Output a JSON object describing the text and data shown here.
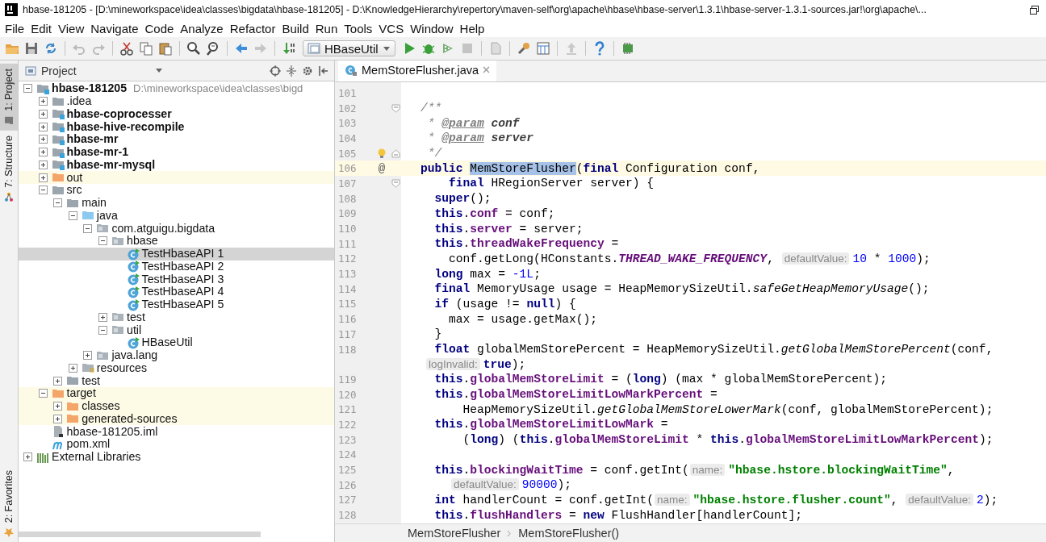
{
  "window": {
    "title": "hbase-181205 - [D:\\mineworkspace\\idea\\classes\\bigdata\\hbase-181205] - D:\\KnowledgeHierarchy\\repertory\\maven-self\\org\\apache\\hbase\\hbase-server\\1.3.1\\hbase-server-1.3.1-sources.jar!\\org\\apache\\..."
  },
  "menu": [
    "File",
    "Edit",
    "View",
    "Navigate",
    "Code",
    "Analyze",
    "Refactor",
    "Build",
    "Run",
    "Tools",
    "VCS",
    "Window",
    "Help"
  ],
  "toolbar": {
    "run_config": "HBaseUtil"
  },
  "tool_windows": [
    {
      "label": "1: Project",
      "selected": true
    },
    {
      "label": "7: Structure",
      "selected": false
    }
  ],
  "tool_windows_bottom": [
    {
      "label": "2: Favorites",
      "selected": false
    }
  ],
  "project": {
    "title": "Project",
    "tree": [
      {
        "label": "hbase-181205",
        "path": "D:\\mineworkspace\\idea\\classes\\bigd",
        "kind": "module",
        "expanded": true,
        "selected": false,
        "children": [
          {
            "label": ".idea",
            "kind": "folder",
            "expanded": false,
            "selected": false
          },
          {
            "label": "hbase-coprocesser",
            "kind": "module",
            "expanded": false,
            "selected": false
          },
          {
            "label": "hbase-hive-recompile",
            "kind": "module",
            "expanded": false,
            "selected": false
          },
          {
            "label": "hbase-mr",
            "kind": "module",
            "expanded": false,
            "selected": false
          },
          {
            "label": "hbase-mr-1",
            "kind": "module",
            "expanded": false,
            "selected": false
          },
          {
            "label": "hbase-mr-mysql",
            "kind": "module",
            "expanded": false,
            "selected": false
          },
          {
            "label": "out",
            "kind": "excluded",
            "expanded": false,
            "selected": false
          },
          {
            "label": "src",
            "kind": "folder",
            "expanded": true,
            "selected": false,
            "children": [
              {
                "label": "main",
                "kind": "folder",
                "expanded": true,
                "selected": false,
                "children": [
                  {
                    "label": "java",
                    "kind": "source",
                    "expanded": true,
                    "selected": false,
                    "children": [
                      {
                        "label": "com.atguigu.bigdata",
                        "kind": "package",
                        "expanded": true,
                        "selected": false,
                        "children": [
                          {
                            "label": "hbase",
                            "kind": "package",
                            "expanded": true,
                            "selected": false,
                            "children": [
                              {
                                "label": "TestHbaseAPI 1",
                                "kind": "class",
                                "selected": true
                              },
                              {
                                "label": "TestHbaseAPI 2",
                                "kind": "class",
                                "selected": false
                              },
                              {
                                "label": "TestHbaseAPI 3",
                                "kind": "class",
                                "selected": false
                              },
                              {
                                "label": "TestHbaseAPI 4",
                                "kind": "class",
                                "selected": false
                              },
                              {
                                "label": "TestHbaseAPI 5",
                                "kind": "class",
                                "selected": false
                              }
                            ]
                          },
                          {
                            "label": "test",
                            "kind": "package",
                            "expanded": false,
                            "selected": false
                          },
                          {
                            "label": "util",
                            "kind": "package",
                            "expanded": true,
                            "selected": false,
                            "children": [
                              {
                                "label": "HBaseUtil",
                                "kind": "class",
                                "selected": false
                              }
                            ]
                          }
                        ]
                      },
                      {
                        "label": "java.lang",
                        "kind": "package",
                        "expanded": false,
                        "selected": false
                      }
                    ]
                  },
                  {
                    "label": "resources",
                    "kind": "resources",
                    "expanded": false,
                    "selected": false
                  }
                ]
              },
              {
                "label": "test",
                "kind": "folder",
                "expanded": false,
                "selected": false
              }
            ]
          },
          {
            "label": "target",
            "kind": "excluded",
            "expanded": true,
            "selected": false,
            "children": [
              {
                "label": "classes",
                "kind": "excluded",
                "expanded": false,
                "selected": false
              },
              {
                "label": "generated-sources",
                "kind": "excluded",
                "expanded": false,
                "selected": false
              }
            ]
          },
          {
            "label": "hbase-181205.iml",
            "kind": "iml",
            "selected": false
          },
          {
            "label": "pom.xml",
            "kind": "maven",
            "selected": false
          }
        ]
      },
      {
        "label": "External Libraries",
        "kind": "libraries",
        "expanded": false,
        "selected": false
      }
    ]
  },
  "editor": {
    "tabs": [
      {
        "label": "MemStoreFlusher.java",
        "selected": true
      }
    ],
    "lines": [
      {
        "number": "101",
        "current": false
      },
      {
        "number": "102",
        "current": false,
        "fold_start": true,
        "segments": [
          {
            "kind": "comment",
            "text": "/**"
          }
        ]
      },
      {
        "number": "103",
        "current": false,
        "segments": [
          {
            "kind": "comment",
            "text": " * "
          },
          {
            "kind": "doctag",
            "text": "@param"
          },
          {
            "kind": "docparam",
            "text": " conf"
          }
        ]
      },
      {
        "number": "104",
        "current": false,
        "segments": [
          {
            "kind": "comment",
            "text": " * "
          },
          {
            "kind": "doctag",
            "text": "@param"
          },
          {
            "kind": "docparam",
            "text": " server"
          }
        ]
      },
      {
        "number": "105",
        "current": false,
        "fold_end": true,
        "bulb": true,
        "segments": [
          {
            "kind": "comment",
            "text": " */"
          }
        ]
      },
      {
        "number": "106",
        "current": true,
        "gutter_mark": "@",
        "segments": [
          {
            "kind": "keyword",
            "text": "public "
          },
          {
            "kind": "selection",
            "text": "MemStoreFlusher"
          },
          {
            "kind": "plain",
            "text": "("
          },
          {
            "kind": "keyword",
            "text": "final "
          },
          {
            "kind": "plain",
            "text": "Configuration conf,"
          }
        ]
      },
      {
        "number": "107",
        "current": false,
        "fold_start": true,
        "segments": [
          {
            "kind": "keyword",
            "text": "    final "
          },
          {
            "kind": "plain",
            "text": "HRegionServer server) {"
          }
        ]
      },
      {
        "number": "108",
        "current": false,
        "segments": [
          {
            "kind": "keyword",
            "text": "  super"
          },
          {
            "kind": "plain",
            "text": "();"
          }
        ]
      },
      {
        "number": "109",
        "current": false,
        "segments": [
          {
            "kind": "keyword",
            "text": "  this"
          },
          {
            "kind": "plain",
            "text": "."
          },
          {
            "kind": "field",
            "text": "conf"
          },
          {
            "kind": "plain",
            "text": " = conf;"
          }
        ]
      },
      {
        "number": "110",
        "current": false,
        "segments": [
          {
            "kind": "keyword",
            "text": "  this"
          },
          {
            "kind": "plain",
            "text": "."
          },
          {
            "kind": "field",
            "text": "server"
          },
          {
            "kind": "plain",
            "text": " = server;"
          }
        ]
      },
      {
        "number": "111",
        "current": false,
        "segments": [
          {
            "kind": "keyword",
            "text": "  this"
          },
          {
            "kind": "plain",
            "text": "."
          },
          {
            "kind": "field",
            "text": "threadWakeFrequency"
          },
          {
            "kind": "plain",
            "text": " ="
          }
        ]
      },
      {
        "number": "112",
        "current": false,
        "segments": [
          {
            "kind": "plain",
            "text": "    conf.getLong(HConstants."
          },
          {
            "kind": "constant",
            "text": "THREAD_WAKE_FREQUENCY"
          },
          {
            "kind": "plain",
            "text": ", "
          },
          {
            "kind": "hint",
            "text": "defaultValue:"
          },
          {
            "kind": "number",
            "text": "10"
          },
          {
            "kind": "plain",
            "text": " * "
          },
          {
            "kind": "number",
            "text": "1000"
          },
          {
            "kind": "plain",
            "text": ");"
          }
        ]
      },
      {
        "number": "113",
        "current": false,
        "segments": [
          {
            "kind": "keyword",
            "text": "  long "
          },
          {
            "kind": "plain",
            "text": "max = "
          },
          {
            "kind": "number",
            "text": "-1L"
          },
          {
            "kind": "plain",
            "text": ";"
          }
        ]
      },
      {
        "number": "114",
        "current": false,
        "segments": [
          {
            "kind": "keyword",
            "text": "  final "
          },
          {
            "kind": "plain",
            "text": "MemoryUsage usage = HeapMemorySizeUtil."
          },
          {
            "kind": "method",
            "text": "safeGetHeapMemoryUsage"
          },
          {
            "kind": "plain",
            "text": "();"
          }
        ]
      },
      {
        "number": "115",
        "current": false,
        "segments": [
          {
            "kind": "keyword",
            "text": "  if "
          },
          {
            "kind": "plain",
            "text": "(usage != "
          },
          {
            "kind": "keyword",
            "text": "null"
          },
          {
            "kind": "plain",
            "text": ") {"
          }
        ]
      },
      {
        "number": "116",
        "current": false,
        "segments": [
          {
            "kind": "plain",
            "text": "    max = usage.getMax();"
          }
        ]
      },
      {
        "number": "117",
        "current": false,
        "segments": [
          {
            "kind": "plain",
            "text": "  }"
          }
        ]
      },
      {
        "number": "118",
        "current": false,
        "segments": [
          {
            "kind": "keyword",
            "text": "  float "
          },
          {
            "kind": "plain",
            "text": "globalMemStorePercent = HeapMemorySizeUtil."
          },
          {
            "kind": "method",
            "text": "getGlobalMemStorePercent"
          },
          {
            "kind": "plain",
            "text": "(conf,"
          }
        ],
        "wrap": [
          {
            "kind": "hint",
            "text": "logInvalid:"
          },
          {
            "kind": "keyword",
            "text": "true"
          },
          {
            "kind": "plain",
            "text": ");"
          }
        ]
      },
      {
        "number": "119",
        "current": false,
        "segments": [
          {
            "kind": "keyword",
            "text": "  this"
          },
          {
            "kind": "plain",
            "text": "."
          },
          {
            "kind": "field",
            "text": "globalMemStoreLimit"
          },
          {
            "kind": "plain",
            "text": " = ("
          },
          {
            "kind": "keyword",
            "text": "long"
          },
          {
            "kind": "plain",
            "text": ") (max * globalMemStorePercent);"
          }
        ]
      },
      {
        "number": "120",
        "current": false,
        "segments": [
          {
            "kind": "keyword",
            "text": "  this"
          },
          {
            "kind": "plain",
            "text": "."
          },
          {
            "kind": "field",
            "text": "globalMemStoreLimitLowMarkPercent"
          },
          {
            "kind": "plain",
            "text": " ="
          }
        ]
      },
      {
        "number": "121",
        "current": false,
        "segments": [
          {
            "kind": "plain",
            "text": "      HeapMemorySizeUtil."
          },
          {
            "kind": "method",
            "text": "getGlobalMemStoreLowerMark"
          },
          {
            "kind": "plain",
            "text": "(conf, globalMemStorePercent);"
          }
        ]
      },
      {
        "number": "122",
        "current": false,
        "segments": [
          {
            "kind": "keyword",
            "text": "  this"
          },
          {
            "kind": "plain",
            "text": "."
          },
          {
            "kind": "field",
            "text": "globalMemStoreLimitLowMark"
          },
          {
            "kind": "plain",
            "text": " ="
          }
        ]
      },
      {
        "number": "123",
        "current": false,
        "segments": [
          {
            "kind": "plain",
            "text": "      ("
          },
          {
            "kind": "keyword",
            "text": "long"
          },
          {
            "kind": "plain",
            "text": ") ("
          },
          {
            "kind": "keyword",
            "text": "this"
          },
          {
            "kind": "plain",
            "text": "."
          },
          {
            "kind": "field",
            "text": "globalMemStoreLimit"
          },
          {
            "kind": "plain",
            "text": " * "
          },
          {
            "kind": "keyword",
            "text": "this"
          },
          {
            "kind": "plain",
            "text": "."
          },
          {
            "kind": "field",
            "text": "globalMemStoreLimitLowMarkPercent"
          },
          {
            "kind": "plain",
            "text": ");"
          }
        ]
      },
      {
        "number": "124",
        "current": false
      },
      {
        "number": "125",
        "current": false,
        "segments": [
          {
            "kind": "keyword",
            "text": "  this"
          },
          {
            "kind": "plain",
            "text": "."
          },
          {
            "kind": "field",
            "text": "blockingWaitTime"
          },
          {
            "kind": "plain",
            "text": " = conf.getInt("
          },
          {
            "kind": "hint",
            "text": "name:"
          },
          {
            "kind": "string",
            "text": "\"hbase.hstore.blockingWaitTime\""
          },
          {
            "kind": "plain",
            "text": ","
          }
        ]
      },
      {
        "number": "126",
        "current": false,
        "segments": [
          {
            "kind": "hint",
            "text": "defaultValue:"
          },
          {
            "kind": "number",
            "text": "90000"
          },
          {
            "kind": "plain",
            "text": ");"
          }
        ]
      },
      {
        "number": "127",
        "current": false,
        "segments": [
          {
            "kind": "keyword",
            "text": "  int "
          },
          {
            "kind": "plain",
            "text": "handlerCount = conf.getInt("
          },
          {
            "kind": "hint",
            "text": "name:"
          },
          {
            "kind": "string",
            "text": "\"hbase.hstore.flusher.count\""
          },
          {
            "kind": "plain",
            "text": ", "
          },
          {
            "kind": "hint",
            "text": "defaultValue:"
          },
          {
            "kind": "number",
            "text": "2"
          },
          {
            "kind": "plain",
            "text": ");"
          }
        ]
      },
      {
        "number": "128",
        "current": false,
        "segments": [
          {
            "kind": "keyword",
            "text": "  this"
          },
          {
            "kind": "plain",
            "text": "."
          },
          {
            "kind": "field",
            "text": "flushHandlers"
          },
          {
            "kind": "plain",
            "text": " = "
          },
          {
            "kind": "keyword",
            "text": "new "
          },
          {
            "kind": "plain",
            "text": "FlushHandler[handlerCount];"
          }
        ]
      }
    ]
  },
  "breadcrumbs": [
    "MemStoreFlusher",
    "MemStoreFlusher()"
  ]
}
